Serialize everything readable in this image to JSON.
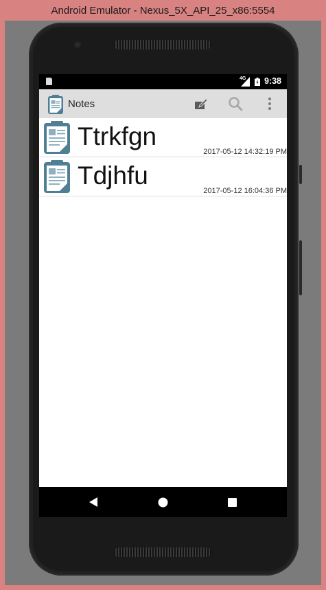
{
  "window": {
    "title": "Android Emulator - Nexus_5X_API_25_x86:5554"
  },
  "status_bar": {
    "network": "4G",
    "time": "9:38"
  },
  "action_bar": {
    "title": "Notes",
    "icons": [
      "notes-app-icon",
      "new-note-icon",
      "search-icon",
      "overflow-menu-icon"
    ]
  },
  "notes": [
    {
      "title": "Ttrkfgn",
      "timestamp": "2017-05-12 14:32:19 PM"
    },
    {
      "title": "Tdjhfu",
      "timestamp": "2017-05-12 16:04:36 PM"
    }
  ],
  "nav_bar": {
    "buttons": [
      "back-icon",
      "home-icon",
      "recents-icon"
    ]
  },
  "colors": {
    "frame": "#d98282",
    "action_bar": "#dedede",
    "icon_blue": "#4f7f95"
  }
}
